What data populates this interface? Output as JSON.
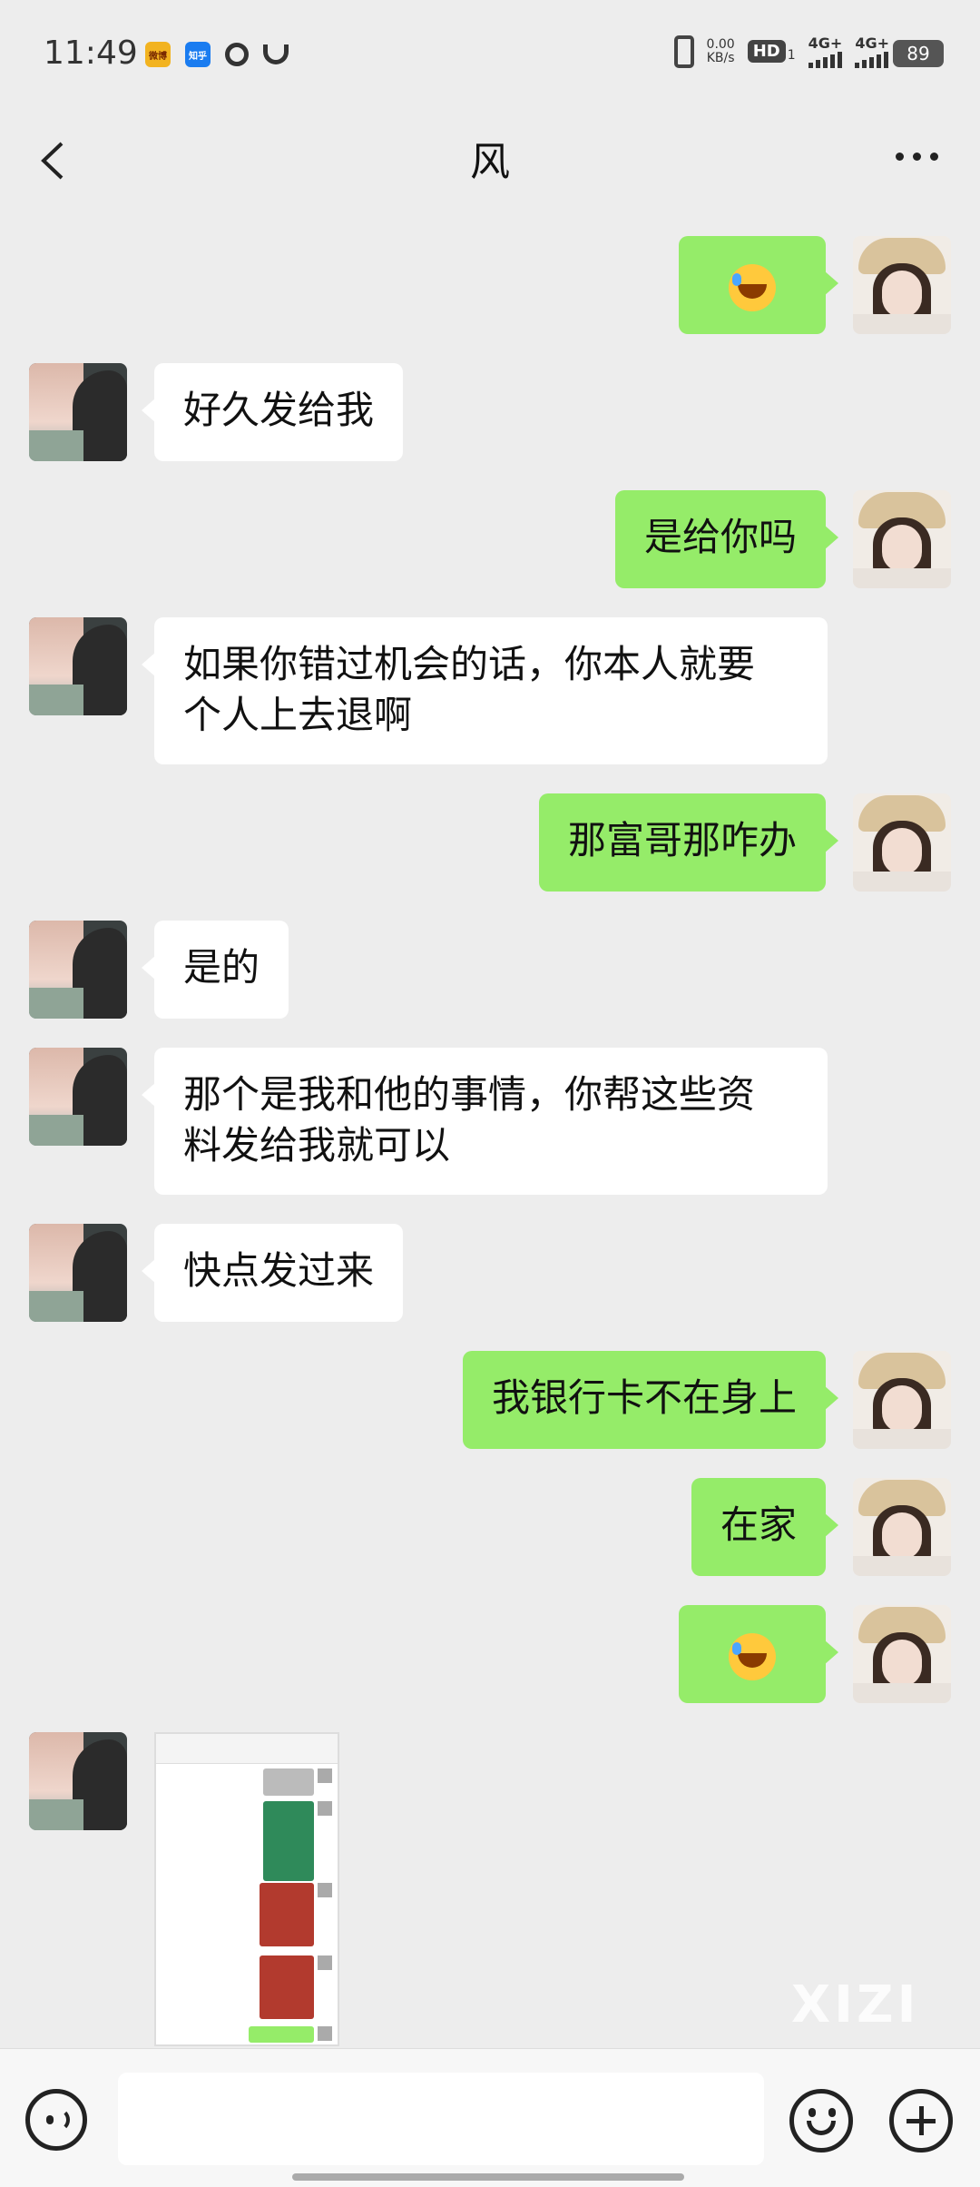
{
  "status_bar": {
    "time": "11:49",
    "apps": [
      "微博",
      "知乎"
    ],
    "speed_top": "0.00",
    "speed_unit": "KB/s",
    "hd": "HD",
    "hd_sub": "1",
    "sig1": "4G+",
    "sig2": "4G+",
    "battery": "89"
  },
  "header": {
    "title": "风"
  },
  "messages": [
    {
      "from": "self",
      "type": "emoji",
      "icon": "crying-laughing-emoji-icon"
    },
    {
      "from": "other",
      "text": "好久发给我"
    },
    {
      "from": "self",
      "text": "是给你吗"
    },
    {
      "from": "other",
      "line1": "如果你错过机会的话，你本人就要",
      "line2": "个人上去退啊"
    },
    {
      "from": "self",
      "text": "那富哥那咋办"
    },
    {
      "from": "other",
      "text": "是的"
    },
    {
      "from": "other",
      "line1": "那个是我和他的事情，你帮这些资",
      "line2": "料发给我就可以"
    },
    {
      "from": "other",
      "text": "快点发过来"
    },
    {
      "from": "self",
      "text": "我银行卡不在身上"
    },
    {
      "from": "self",
      "text": "在家"
    },
    {
      "from": "self",
      "type": "emoji",
      "icon": "crying-laughing-emoji-icon"
    },
    {
      "from": "other",
      "type": "image",
      "description": "screenshot"
    }
  ],
  "watermark": "XIZI",
  "input": {
    "value": "",
    "placeholder": ""
  }
}
